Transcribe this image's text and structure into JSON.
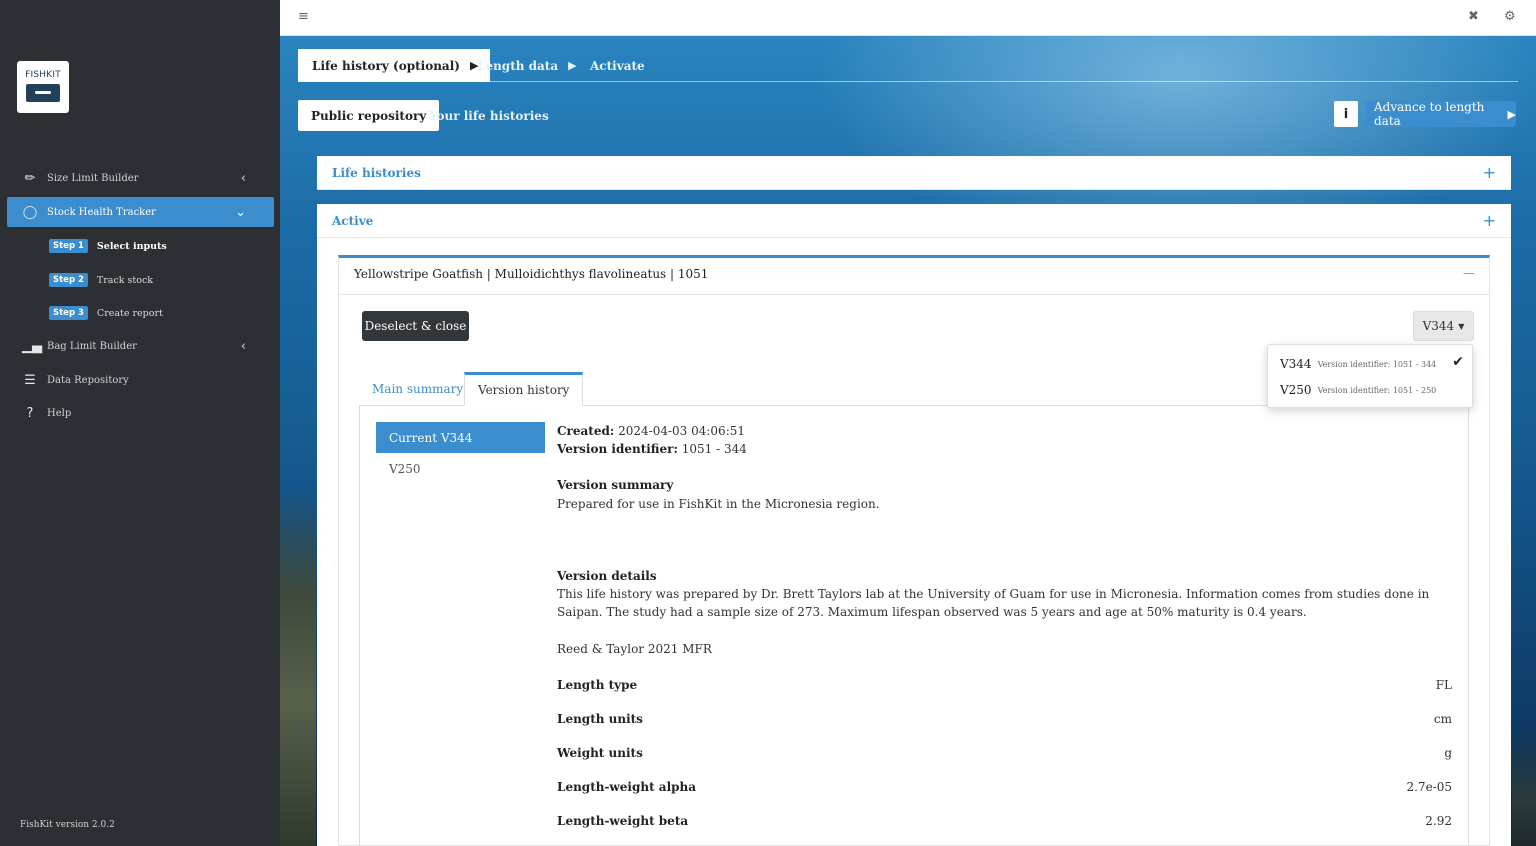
{
  "sidebar": {
    "logo_text": "FISHKIT",
    "items": [
      {
        "label": "Size Limit Builder",
        "icon": "ruler-icon"
      },
      {
        "label": "Stock Health Tracker",
        "icon": "circle-notch-icon"
      },
      {
        "label": "Bag Limit Builder",
        "icon": "bar-chart-icon"
      },
      {
        "label": "Data Repository",
        "icon": "database-icon"
      },
      {
        "label": "Help",
        "icon": "question-icon"
      }
    ],
    "steps": [
      {
        "badge": "Step 1",
        "label": "Select inputs"
      },
      {
        "badge": "Step 2",
        "label": "Track stock"
      },
      {
        "badge": "Step 3",
        "label": "Create report"
      }
    ],
    "version": "FishKit version 2.0.2"
  },
  "wizard_tabs": [
    {
      "label": "Life history (optional)"
    },
    {
      "label": "Length data"
    },
    {
      "label": "Activate"
    }
  ],
  "repo_tabs": {
    "public": "Public repository",
    "yours": "Your life histories"
  },
  "info_label": "i",
  "advance_label": "Advance to length data",
  "panels": {
    "life_histories": "Life histories",
    "active": "Active"
  },
  "card": {
    "title": "Yellowstripe Goatfish | Mulloidichthys flavolineatus | 1051",
    "deselect_label": "Deselect & close",
    "version_selected": "V344",
    "inner_tabs": {
      "main": "Main summary",
      "history": "Version history"
    },
    "versions_list": {
      "current": "Current V344",
      "old": "V250"
    },
    "created_label": "Created:",
    "created_value": "2024-04-03 04:06:51",
    "identifier_label": "Version identifier:",
    "identifier_value": "1051 - 344",
    "summary_heading": "Version summary",
    "summary_text": "Prepared for use in FishKit in the Micronesia region.",
    "details_heading": "Version details",
    "details_text": "This life history was prepared by Dr. Brett Taylors lab at the University of Guam for use in Micronesia. Information comes from studies done in Saipan. The study had a sample size of 273. Maximum lifespan observed was 5 years and age at 50% maturity is 0.4 years.",
    "reference": "Reed & Taylor 2021 MFR",
    "fields": [
      {
        "label": "Length type",
        "value": "FL"
      },
      {
        "label": "Length units",
        "value": "cm"
      },
      {
        "label": "Weight units",
        "value": "g"
      },
      {
        "label": "Length-weight alpha",
        "value": "2.7e-05"
      },
      {
        "label": "Length-weight beta",
        "value": "2.92"
      }
    ]
  },
  "dropdown": {
    "options": [
      {
        "name": "V344",
        "sub": "Version identifier: 1051 - 344",
        "checked": true
      },
      {
        "name": "V250",
        "sub": "Version identifier: 1051 - 250",
        "checked": false
      }
    ]
  },
  "colors": {
    "accent": "#3c8dce",
    "sidebar": "#2c3034",
    "dark_button": "#32373b"
  }
}
